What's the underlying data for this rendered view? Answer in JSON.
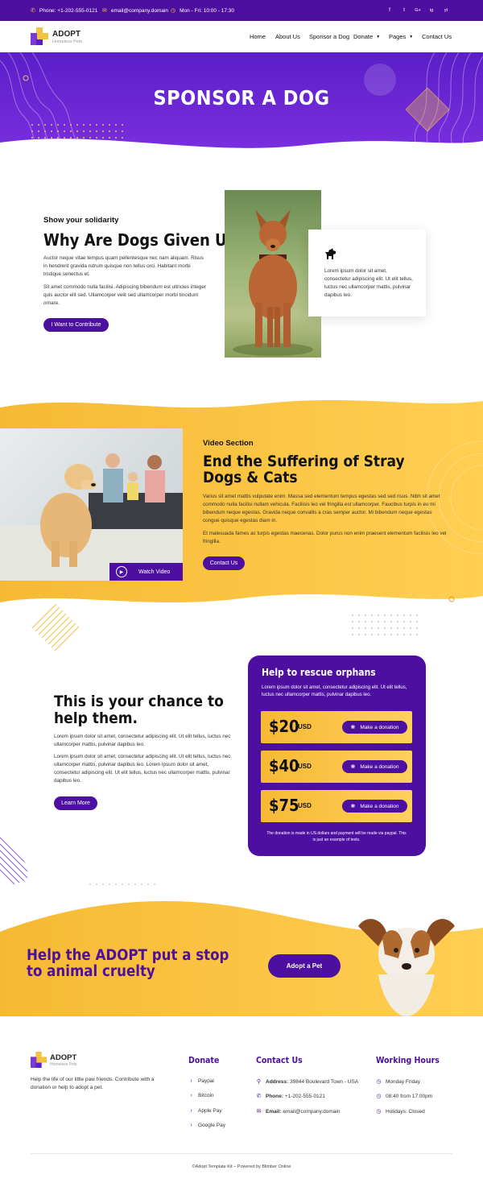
{
  "topbar": {
    "phone": "Phone: +1-202-555-0121",
    "email": "email@company.domain",
    "hours": "Mon - Fri: 10:00 - 17:30",
    "social": [
      "f",
      "t",
      "G+",
      "ig",
      "yt"
    ]
  },
  "brand": {
    "name": "ADOPT",
    "tagline": "Homeless Pets"
  },
  "nav": {
    "items": [
      "Home",
      "About Us",
      "Sponsor a Dog",
      "Donate",
      "Pages",
      "Contact Us"
    ]
  },
  "hero": {
    "title": "SPONSOR A DOG"
  },
  "solidarity": {
    "eyebrow": "Show your solidarity",
    "title": "Why Are Dogs Given Up?",
    "p1": "Auctor neque vitae tempus quam pellentesque nec nam aliquam. Risus in hendrerit gravida rutrum quisque non tellus orci. Habitant morbi tristique senectus et.",
    "p2": "Sit amet commodo nulla facilisi. Adipiscing bibendum est ultricies integer quis auctor elit sed. Ullamcorper velit sed ullamcorper morbi tincidunt ornare.",
    "button": "I Want to Contribute",
    "card_text": "Lorem ipsum dolor sit amet, consectetur adipiscing elit. Ut elit tellus, luctus nec ullamcorper mattis, pulvinar dapibus leo."
  },
  "video": {
    "eyebrow": "Video Section",
    "title": "End the Suffering of Stray Dogs & Cats",
    "p1": "Varius sit amet mattis vulputate enim. Massa sed elementum tempus egestas sed sed risus. Nibh sit amet commodo nulla facilisi nullam vehicula. Facilisis leo vel fringilla est ullamcorper. Faucibus turpis in eu mi bibendum neque egestas. Gravida neque convallis a cras semper auctor. Mi bibendum neque egestas congue quisque egestas diam in.",
    "p2": "Et malesuada fames ac turpis egestas maecenas. Dolor purus non enim praesent elementum facilisis leo vel fringilla.",
    "button": "Contact Us",
    "watch": "Watch Video"
  },
  "chance": {
    "title": "This is your chance to help them.",
    "p1": "Lorem ipsum dolor sit amet, consectetur adipiscing elit. Ut elit tellus, luctus nec ullamcorper mattis, pulvinar dapibus leo.",
    "p2": "Lorem ipsum dolor sit amet, consectetur adipiscing elit. Ut elit tellus, luctus nec ullamcorper mattis, pulvinar dapibus leo. Lorem ipsum dolor sit amet, consectetur adipiscing elit. Ut elit tellus, luctus nec ullamcorper mattis, pulvinar dapibus leo.",
    "button": "Learn More"
  },
  "rescue": {
    "title": "Help to rescue orphans",
    "text": "Lorem ipsum dolor sit amet, consectetur adipiscing elit. Ut elit tellus, luctus nec ullamcorper mattis, pulvinar dapibus leo.",
    "donations": [
      {
        "amount": "$20",
        "currency": "USD",
        "button": "Make a donation"
      },
      {
        "amount": "$40",
        "currency": "USD",
        "button": "Make a donation"
      },
      {
        "amount": "$75",
        "currency": "USD",
        "button": "Make a donation"
      }
    ],
    "note": "The donation is made in US dollars and payment will be made via paypal. This is just an example of tests."
  },
  "cta": {
    "title": "Help the ADOPT put a stop to animal cruelty",
    "button": "Adopt a Pet"
  },
  "footer": {
    "about": "Help the life of our little paw friends. Contribute with a donation or help to adopt a pet.",
    "donate_heading": "Donate",
    "donate_items": [
      "Paypal",
      "Bitcoin",
      "Apple Pay",
      "Google Pay"
    ],
    "contact_heading": "Contact Us",
    "contact": [
      {
        "label": "Address:",
        "value": "39844 Boulevard Town - USA"
      },
      {
        "label": "Phone:",
        "value": "+1-202-555-0121"
      },
      {
        "label": "Email:",
        "value": "email@company.domain"
      }
    ],
    "hours_heading": "Working Hours",
    "hours": [
      "Monday Friday",
      "08:40 from 17:00pm",
      "Holidays: Closed"
    ],
    "copyright": "©Adopt Template Kit – Powered by Blimber Online"
  },
  "colors": {
    "primary": "#4d0fa0",
    "accent": "#f6b934"
  }
}
